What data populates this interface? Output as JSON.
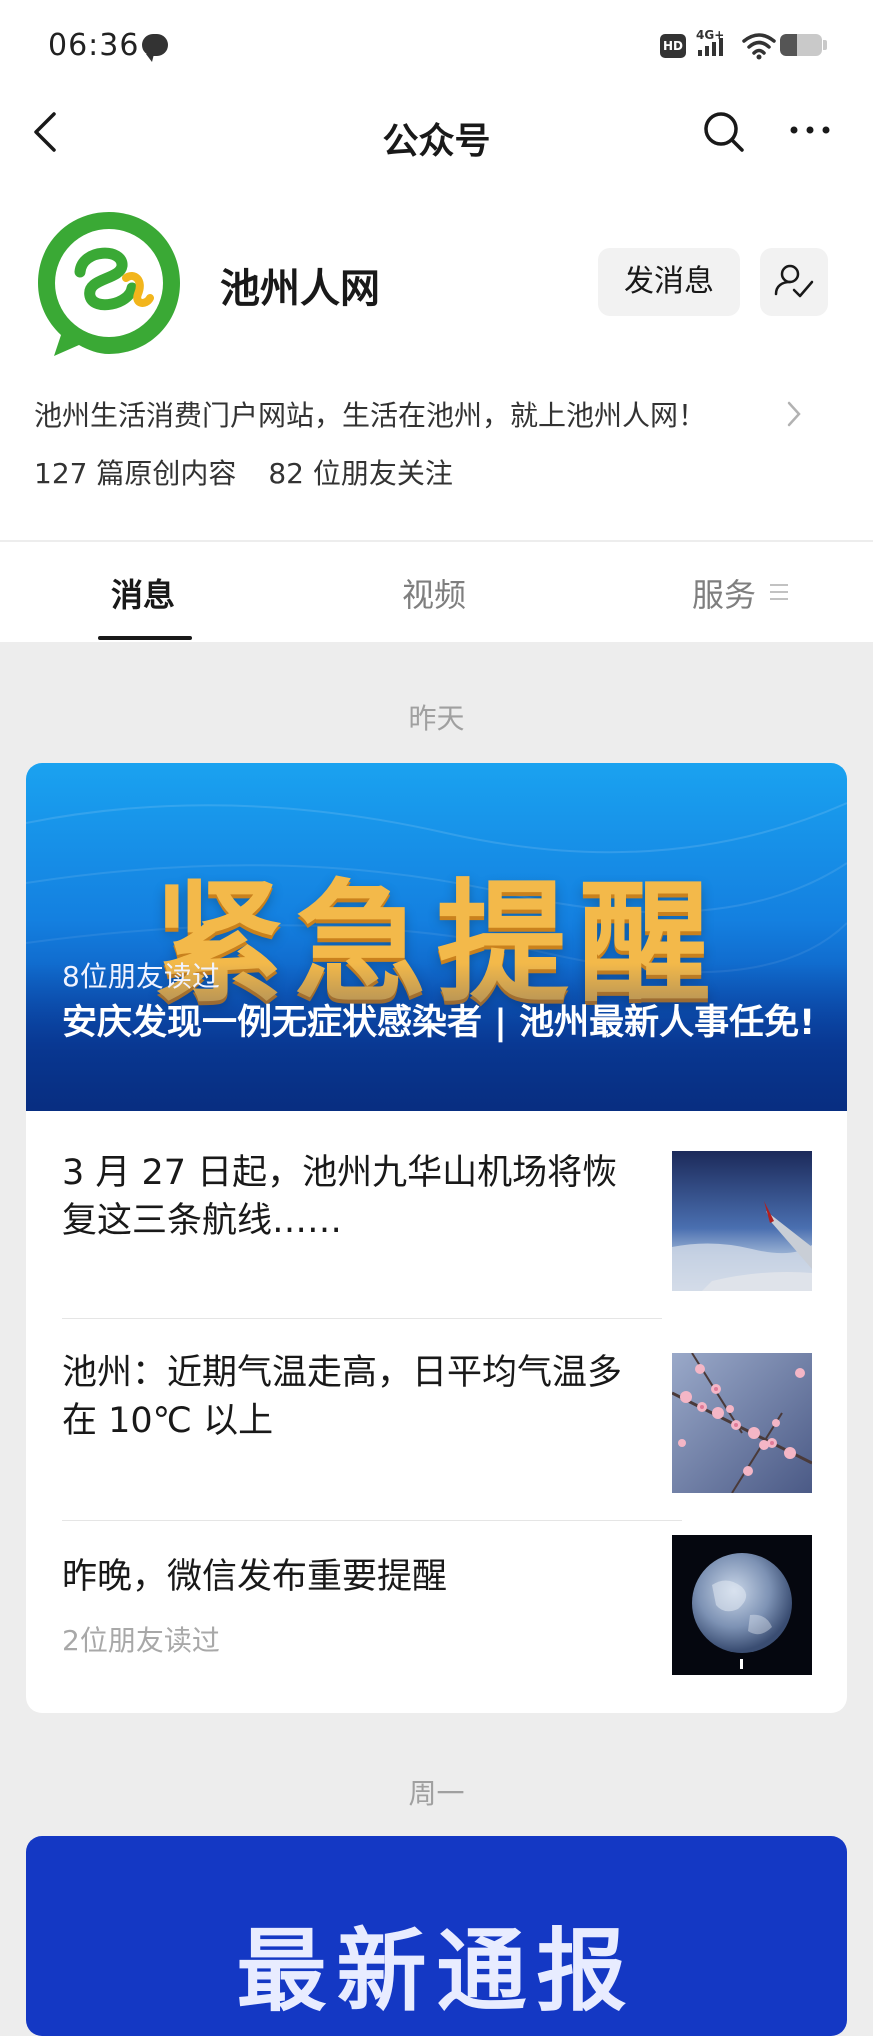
{
  "status_bar": {
    "time": "06:36",
    "network": "4G+",
    "hd_badge": "HD",
    "battery_level": 0.4
  },
  "nav": {
    "title": "公众号"
  },
  "profile": {
    "name": "池州人网",
    "message_button": "发消息",
    "description": "池州生活消费门户网站，生活在池州，就上池州人网！",
    "originals": "127 篇原创内容",
    "followers": "82 位朋友关注"
  },
  "tabs": [
    {
      "label": "消息",
      "active": true
    },
    {
      "label": "视频",
      "active": false
    },
    {
      "label": "服务",
      "active": false
    }
  ],
  "feed": {
    "group1": {
      "date": "昨天",
      "hero": {
        "image_text": "紧急提醒",
        "friends_read": "8位朋友读过",
        "title": "安庆发现一例无症状感染者 | 池州最新人事任免!"
      },
      "items": [
        {
          "title": "3 月 27 日起，池州九华山机场将恢复这三条航线……",
          "friends_read": ""
        },
        {
          "title": "池州：近期气温走高，日平均气温多在 10℃ 以上",
          "friends_read": ""
        },
        {
          "title": "昨晚，微信发布重要提醒",
          "friends_read": "2位朋友读过"
        }
      ]
    },
    "group2": {
      "date": "周一",
      "hero_image_text": "最新通报"
    }
  },
  "icons": {
    "back": "chevron-left-icon",
    "search": "search-icon",
    "more": "more-horizontal-icon",
    "follow": "user-check-icon",
    "desc_chevron": "chevron-right-icon",
    "tab_list": "list-icon"
  },
  "colors": {
    "brand_green": "#3aa935",
    "page_bg": "#ededed",
    "hero_blue": "#1480e0"
  }
}
